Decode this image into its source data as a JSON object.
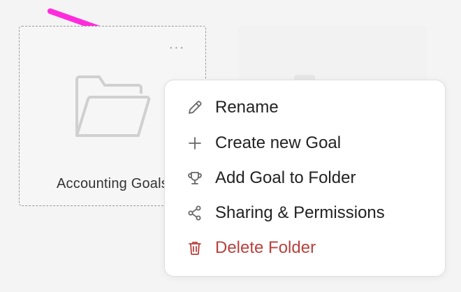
{
  "card": {
    "title": "Accounting Goals",
    "more_label": "···"
  },
  "menu": {
    "items": [
      {
        "label": "Rename",
        "icon": "pencil-icon"
      },
      {
        "label": "Create new Goal",
        "icon": "plus-icon"
      },
      {
        "label": "Add Goal to Folder",
        "icon": "trophy-icon"
      },
      {
        "label": "Sharing & Permissions",
        "icon": "share-icon"
      },
      {
        "label": "Delete Folder",
        "icon": "trash-icon"
      }
    ]
  },
  "colors": {
    "annotation_arrow": "#ff2bdc",
    "danger": "#b8413c"
  }
}
